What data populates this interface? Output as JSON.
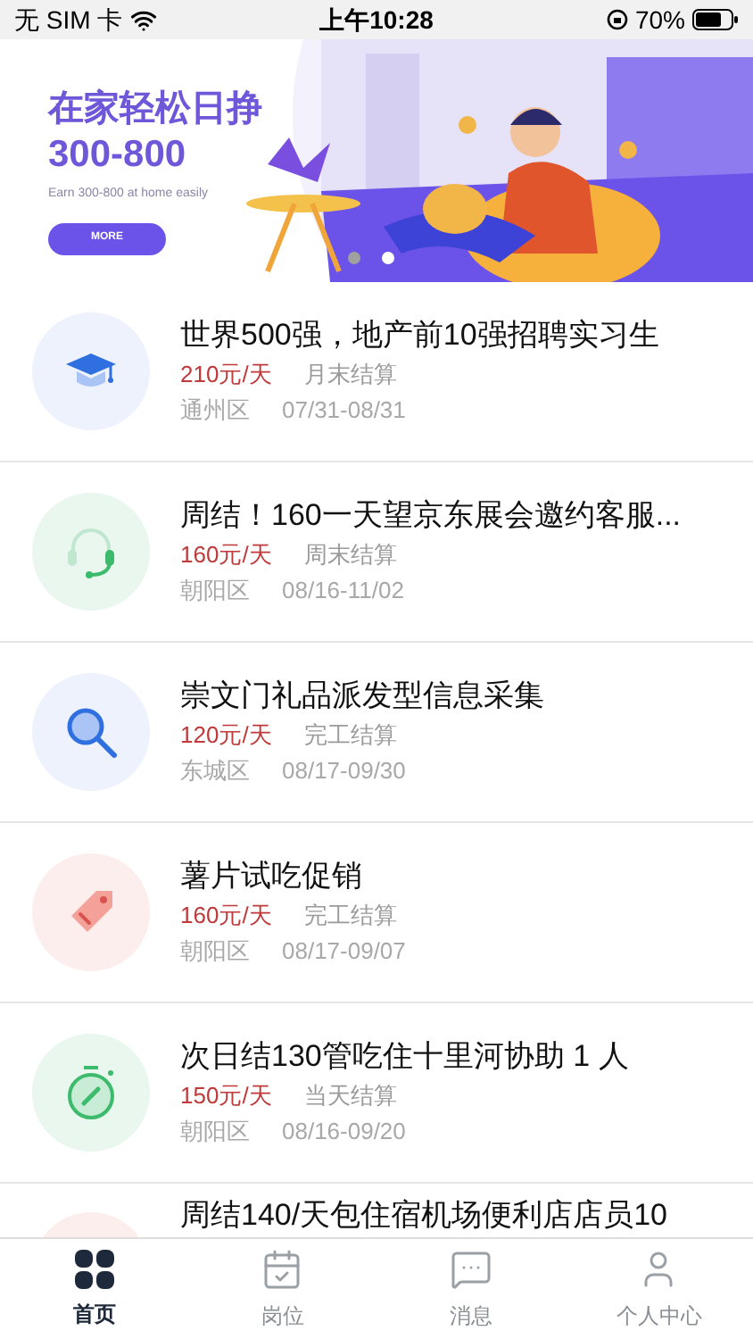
{
  "status_bar": {
    "carrier": "无 SIM 卡",
    "time": "上午10:28",
    "battery": "70%"
  },
  "banner": {
    "title": "在家轻松日挣",
    "amount": "300-800",
    "subtitle": "Earn 300-800 at home easily",
    "button": "MORE",
    "dots": [
      {
        "selected": false
      },
      {
        "selected": true
      }
    ]
  },
  "jobs": [
    {
      "kind": "full",
      "title": "世界500强，地产前10强招聘实习生",
      "pay": "210元/天",
      "settle": "月末结算",
      "district": "通州区",
      "dates": "07/31-08/31"
    },
    {
      "kind": "full",
      "title": "周结！160一天望京东展会邀约客服...",
      "pay": "160元/天",
      "settle": "周末结算",
      "district": "朝阳区",
      "dates": "08/16-11/02"
    },
    {
      "kind": "full",
      "title": "崇文门礼品派发型信息采集",
      "pay": "120元/天",
      "settle": "完工结算",
      "district": "东城区",
      "dates": "08/17-09/30"
    },
    {
      "kind": "full",
      "title": "薯片试吃促销",
      "pay": "160元/天",
      "settle": "完工结算",
      "district": "朝阳区",
      "dates": "08/17-09/07"
    },
    {
      "kind": "full",
      "title": "次日结130管吃住十里河协助 1 人",
      "pay": "150元/天",
      "settle": "当天结算",
      "district": "朝阳区",
      "dates": "08/16-09/20"
    },
    {
      "kind": "partial",
      "title": "周结140/天包住宿机场便利店店员10"
    }
  ],
  "tabs": [
    {
      "label": "首页",
      "selected": true
    },
    {
      "label": "岗位",
      "selected": false
    },
    {
      "label": "消息",
      "selected": false
    },
    {
      "label": "个人中心",
      "selected": false
    }
  ]
}
